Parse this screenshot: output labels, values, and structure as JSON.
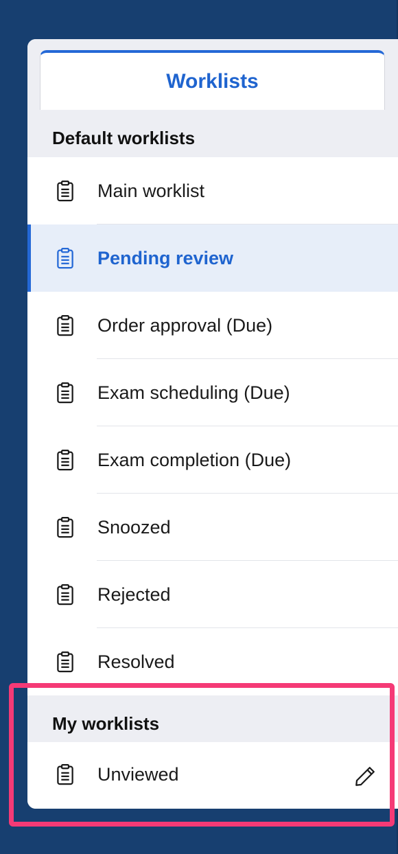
{
  "tab": {
    "label": "Worklists"
  },
  "sections": {
    "default": {
      "title": "Default worklists"
    },
    "mine": {
      "title": "My worklists"
    }
  },
  "default_items": [
    {
      "label": "Main worklist",
      "icon": "clipboard-icon"
    },
    {
      "label": "Pending review",
      "icon": "clipboard-icon",
      "active": true
    },
    {
      "label": "Order approval (Due)",
      "icon": "clipboard-icon"
    },
    {
      "label": "Exam scheduling (Due)",
      "icon": "clipboard-icon"
    },
    {
      "label": "Exam completion (Due)",
      "icon": "clipboard-icon"
    },
    {
      "label": "Snoozed",
      "icon": "clipboard-icon"
    },
    {
      "label": "Rejected",
      "icon": "clipboard-icon"
    },
    {
      "label": "Resolved",
      "icon": "clipboard-icon"
    }
  ],
  "my_items": [
    {
      "label": "Unviewed",
      "icon": "clipboard-icon",
      "action_icon": "pencil-icon"
    }
  ],
  "colors": {
    "accent": "#2468d6",
    "background": "#173f70",
    "highlight": "#f53a76",
    "active_row": "#e7eef9"
  }
}
